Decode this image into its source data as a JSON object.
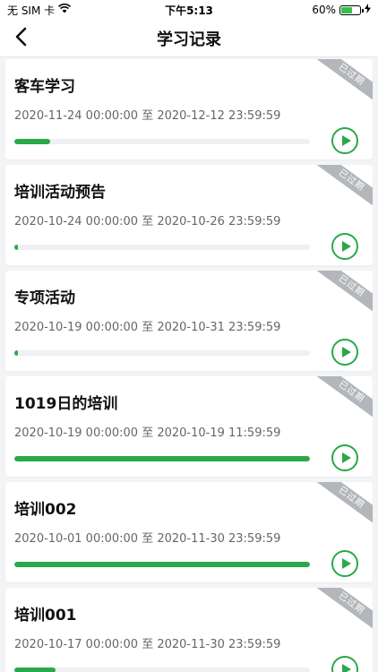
{
  "status_bar": {
    "carrier": "无 SIM 卡",
    "time": "下午5:13",
    "battery_percent": "60%",
    "battery_level": 0.6
  },
  "nav": {
    "title": "学习记录",
    "back_icon": "chevron-left-icon"
  },
  "colors": {
    "accent": "#2aa84a",
    "ribbon": "#b3b6ba",
    "list_bg": "#f3f4f6"
  },
  "records": [
    {
      "title": "客车学习",
      "date_range": "2020-11-24 00:00:00 至 2020-12-12 23:59:59",
      "progress": 0.12,
      "badge": "已过期"
    },
    {
      "title": "培训活动预告",
      "date_range": "2020-10-24 00:00:00 至 2020-10-26 23:59:59",
      "progress": 0.01,
      "badge": "已过期"
    },
    {
      "title": "专项活动",
      "date_range": "2020-10-19 00:00:00 至 2020-10-31 23:59:59",
      "progress": 0.01,
      "badge": "已过期"
    },
    {
      "title": "1019日的培训",
      "date_range": "2020-10-19 00:00:00 至 2020-10-19 11:59:59",
      "progress": 1.0,
      "badge": "已过期"
    },
    {
      "title": "培训002",
      "date_range": "2020-10-01 00:00:00 至 2020-11-30 23:59:59",
      "progress": 1.0,
      "badge": "已过期"
    },
    {
      "title": "培训001",
      "date_range": "2020-10-17 00:00:00 至 2020-11-30 23:59:59",
      "progress": 0.14,
      "badge": "已过期"
    }
  ]
}
